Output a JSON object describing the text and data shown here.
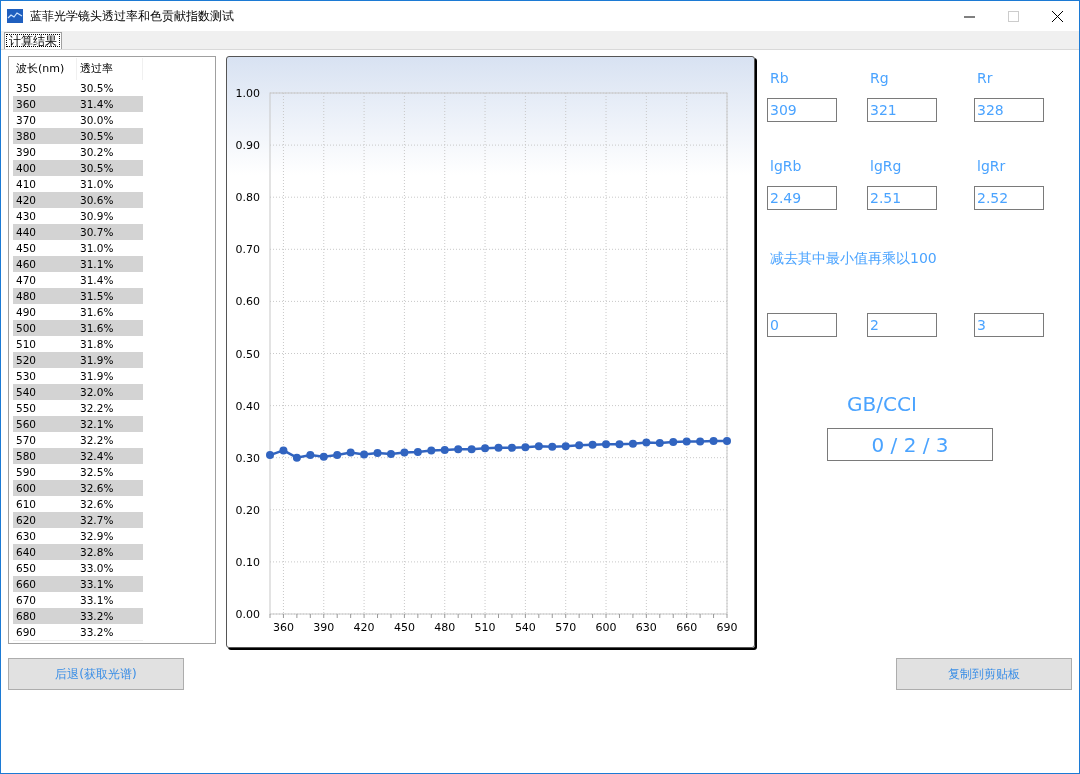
{
  "window": {
    "title": "蓝菲光学镜头透过率和色贡献指数测试"
  },
  "tabs": [
    {
      "label": "计算结果",
      "selected": true
    }
  ],
  "table": {
    "columns": [
      "波长(nm)",
      "透过率"
    ],
    "rows": [
      [
        "350",
        "30.5%"
      ],
      [
        "360",
        "31.4%"
      ],
      [
        "370",
        "30.0%"
      ],
      [
        "380",
        "30.5%"
      ],
      [
        "390",
        "30.2%"
      ],
      [
        "400",
        "30.5%"
      ],
      [
        "410",
        "31.0%"
      ],
      [
        "420",
        "30.6%"
      ],
      [
        "430",
        "30.9%"
      ],
      [
        "440",
        "30.7%"
      ],
      [
        "450",
        "31.0%"
      ],
      [
        "460",
        "31.1%"
      ],
      [
        "470",
        "31.4%"
      ],
      [
        "480",
        "31.5%"
      ],
      [
        "490",
        "31.6%"
      ],
      [
        "500",
        "31.6%"
      ],
      [
        "510",
        "31.8%"
      ],
      [
        "520",
        "31.9%"
      ],
      [
        "530",
        "31.9%"
      ],
      [
        "540",
        "32.0%"
      ],
      [
        "550",
        "32.2%"
      ],
      [
        "560",
        "32.1%"
      ],
      [
        "570",
        "32.2%"
      ],
      [
        "580",
        "32.4%"
      ],
      [
        "590",
        "32.5%"
      ],
      [
        "600",
        "32.6%"
      ],
      [
        "610",
        "32.6%"
      ],
      [
        "620",
        "32.7%"
      ],
      [
        "630",
        "32.9%"
      ],
      [
        "640",
        "32.8%"
      ],
      [
        "650",
        "33.0%"
      ],
      [
        "660",
        "33.1%"
      ],
      [
        "670",
        "33.1%"
      ],
      [
        "680",
        "33.2%"
      ],
      [
        "690",
        "33.2%"
      ]
    ]
  },
  "chart": {
    "chart_data": {
      "type": "line",
      "x": [
        350,
        360,
        370,
        380,
        390,
        400,
        410,
        420,
        430,
        440,
        450,
        460,
        470,
        480,
        490,
        500,
        510,
        520,
        530,
        540,
        550,
        560,
        570,
        580,
        590,
        600,
        610,
        620,
        630,
        640,
        650,
        660,
        670,
        680,
        690
      ],
      "grid": true,
      "series": [
        {
          "color": "#3164c0",
          "marker": true,
          "values": [
            0.305,
            0.314,
            0.3,
            0.305,
            0.302,
            0.305,
            0.31,
            0.306,
            0.309,
            0.307,
            0.31,
            0.311,
            0.314,
            0.315,
            0.316,
            0.316,
            0.318,
            0.319,
            0.319,
            0.32,
            0.322,
            0.321,
            0.322,
            0.324,
            0.325,
            0.326,
            0.326,
            0.327,
            0.329,
            0.328,
            0.33,
            0.331,
            0.331,
            0.332,
            0.332
          ]
        }
      ],
      "xlim": [
        350,
        690
      ],
      "ylim": [
        0,
        1
      ],
      "xticks": [
        360,
        390,
        420,
        450,
        480,
        510,
        540,
        570,
        600,
        630,
        660,
        690
      ],
      "yticks": [
        {
          "value": 0,
          "label": "0.00"
        },
        {
          "value": 0.1,
          "label": "0.10"
        },
        {
          "value": 0.2,
          "label": "0.20"
        },
        {
          "value": 0.3,
          "label": "0.30"
        },
        {
          "value": 0.4,
          "label": "0.40"
        },
        {
          "value": 0.5,
          "label": "0.50"
        },
        {
          "value": 0.6,
          "label": "0.60"
        },
        {
          "value": 0.7,
          "label": "0.70"
        },
        {
          "value": 0.8,
          "label": "0.80"
        },
        {
          "value": 0.9,
          "label": "0.90"
        },
        {
          "value": 1,
          "label": "1.00"
        }
      ]
    }
  },
  "results": {
    "raw_labels": [
      "Rb",
      "Rg",
      "Rr"
    ],
    "raw_values": [
      "309",
      "321",
      "328"
    ],
    "log_labels": [
      "lgRb",
      "lgRg",
      "lgRr"
    ],
    "log_values": [
      "2.49",
      "2.51",
      "2.52"
    ],
    "note": "减去其中最小值再乘以100",
    "scaled_values": [
      "0",
      "2",
      "3"
    ],
    "index_label": "GB/CCI",
    "index_value": "0 / 2 / 3"
  },
  "buttons": [
    {
      "label": "后退(获取光谱)"
    },
    {
      "label": "复制到剪贴板"
    }
  ]
}
